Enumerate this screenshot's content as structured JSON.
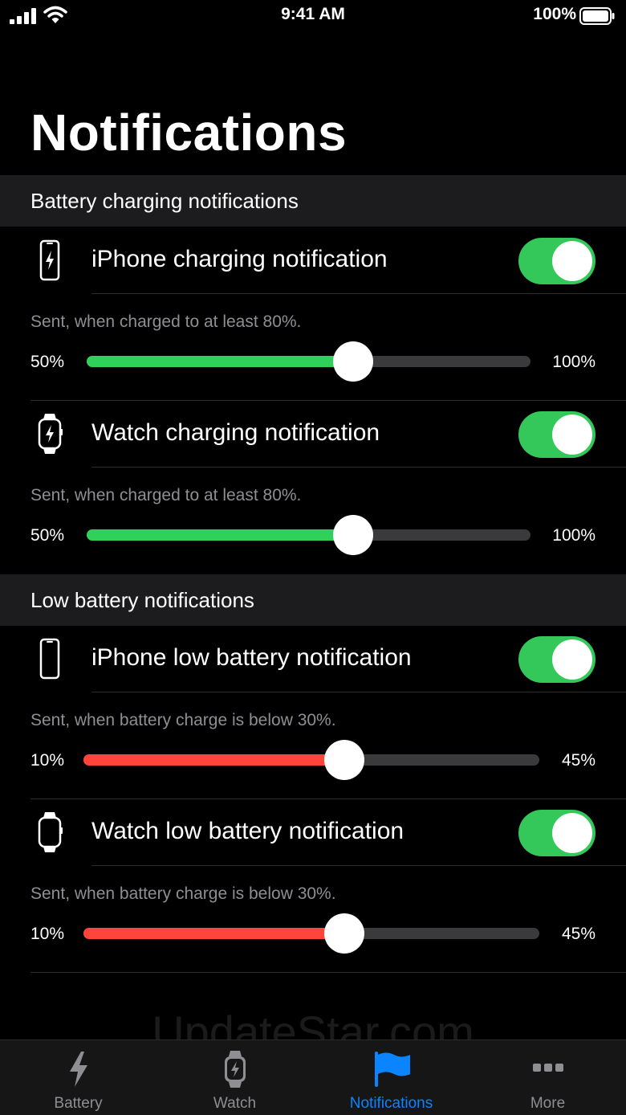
{
  "status_bar": {
    "time": "9:41 AM",
    "battery_percent": "100%"
  },
  "title": "Notifications",
  "sections": {
    "charging": {
      "header": "Battery charging notifications"
    },
    "low": {
      "header": "Low battery notifications"
    }
  },
  "rows": {
    "iphone_charging": {
      "label": "iPhone charging notification",
      "enabled": true,
      "icon": "iphone-charging-icon",
      "description": "Sent, when charged to at least 80%.",
      "slider": {
        "min_label": "50%",
        "max_label": "100%",
        "min": 50,
        "max": 100,
        "value": 80,
        "color": "#30d158"
      }
    },
    "watch_charging": {
      "label": "Watch charging notification",
      "enabled": true,
      "icon": "watch-charging-icon",
      "description": "Sent, when charged to at least 80%.",
      "slider": {
        "min_label": "50%",
        "max_label": "100%",
        "min": 50,
        "max": 100,
        "value": 80,
        "color": "#30d158"
      }
    },
    "iphone_low": {
      "label": "iPhone low battery notification",
      "enabled": true,
      "icon": "iphone-icon",
      "description": "Sent, when battery charge is below 30%.",
      "slider": {
        "min_label": "10%",
        "max_label": "45%",
        "min": 10,
        "max": 45,
        "value": 30,
        "color": "#ff453a"
      }
    },
    "watch_low": {
      "label": "Watch low battery notification",
      "enabled": true,
      "icon": "watch-icon",
      "description": "Sent, when battery charge is below 30%.",
      "slider": {
        "min_label": "10%",
        "max_label": "45%",
        "min": 10,
        "max": 45,
        "value": 30,
        "color": "#ff453a"
      }
    }
  },
  "watermark": "UpdateStar.com",
  "tabs": [
    {
      "label": "Battery",
      "icon": "bolt-icon",
      "active": false
    },
    {
      "label": "Watch",
      "icon": "watch-bolt-icon",
      "active": false
    },
    {
      "label": "Notifications",
      "icon": "flag-icon",
      "active": true
    },
    {
      "label": "More",
      "icon": "more-dots-icon",
      "active": false
    }
  ],
  "colors": {
    "accent": "#0a84ff",
    "toggle_on": "#34c759",
    "charging": "#30d158",
    "low": "#ff453a"
  }
}
